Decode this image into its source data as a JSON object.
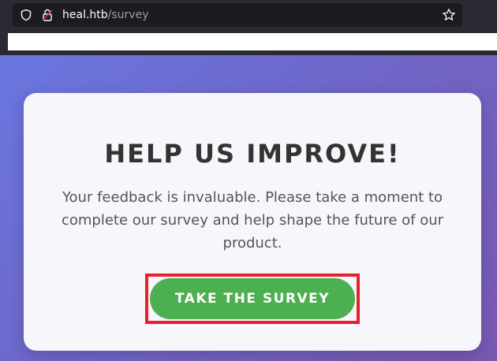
{
  "browser": {
    "url_host": "heal.htb",
    "url_path": "/survey",
    "icons": [
      "shield-icon",
      "lock-icon",
      "star-icon"
    ]
  },
  "page": {
    "title": "HELP US IMPROVE!",
    "description": "Your feedback is invaluable. Please take a moment to complete our survey and help shape the future of our product.",
    "button_label": "TAKE THE SURVEY"
  },
  "colors": {
    "background_gradient": [
      "#6a76e0",
      "#7a58b2"
    ],
    "card": "#f7f6fb",
    "button": "#4caf50",
    "highlight": "#e8202a"
  }
}
